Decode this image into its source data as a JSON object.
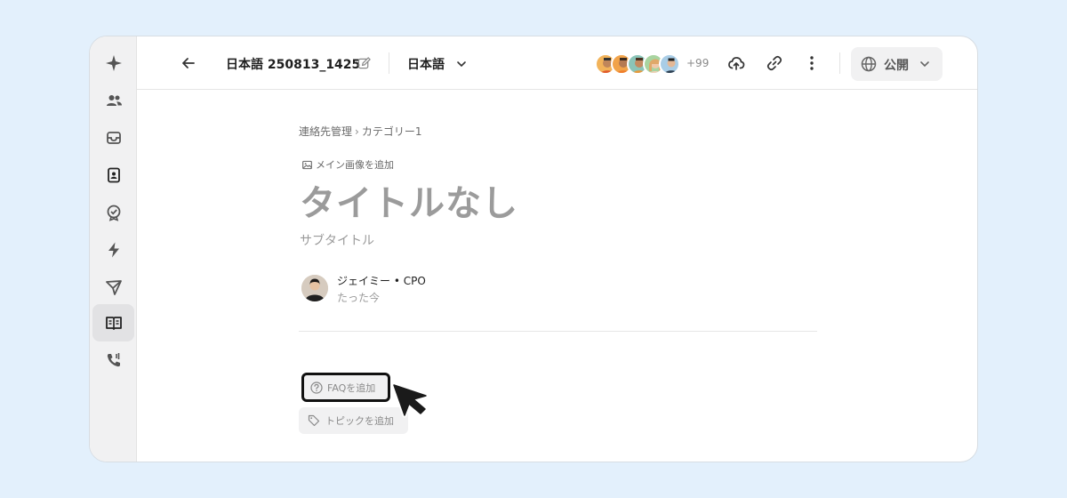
{
  "sidebar": {
    "items": [
      {
        "icon": "sparkle-icon"
      },
      {
        "icon": "users-icon"
      },
      {
        "icon": "inbox-icon"
      },
      {
        "icon": "contact-card-icon"
      },
      {
        "icon": "badge-check-icon"
      },
      {
        "icon": "lightning-icon"
      },
      {
        "icon": "send-icon"
      },
      {
        "icon": "book-icon",
        "active": true
      },
      {
        "icon": "phone-icon"
      }
    ]
  },
  "header": {
    "doc_title": "日本語 250813_1425",
    "language": "日本語",
    "collaborators_more": "+99",
    "publish_label": "公開"
  },
  "article": {
    "breadcrumb": {
      "parent": "連絡先管理",
      "separator": "›",
      "current": "カテゴリー1"
    },
    "add_image_label": "メイン画像を追加",
    "title_placeholder": "タイトルなし",
    "subtitle_placeholder": "サブタイトル",
    "author": {
      "name": "ジェイミー • CPO",
      "time": "たった今"
    },
    "add_faq_label": "FAQを追加",
    "add_topic_label": "トピックを追加"
  },
  "colors": {
    "background": "#e3f0fc",
    "accent": "#111111"
  }
}
